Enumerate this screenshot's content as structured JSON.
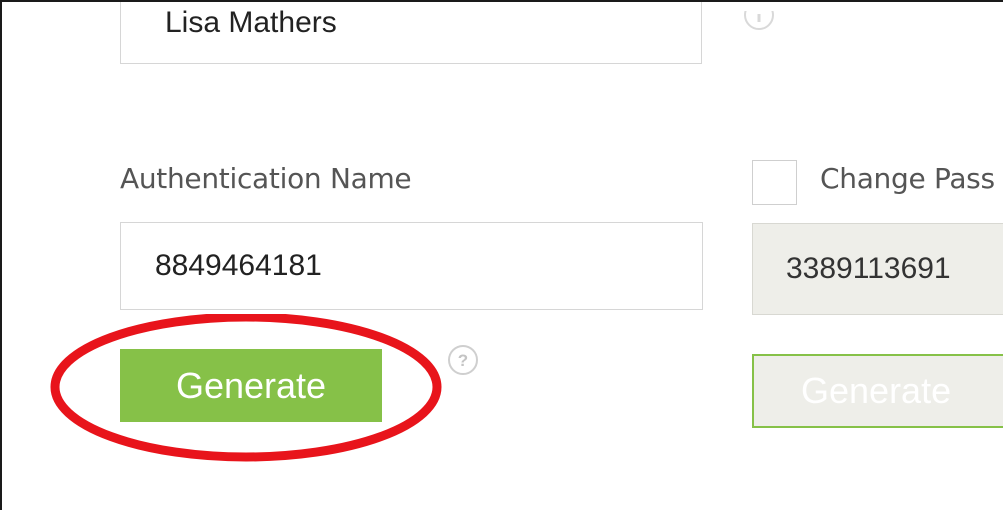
{
  "user_select": {
    "value": "Lisa Mathers",
    "caret_icon": "chevron-down-icon"
  },
  "authentication": {
    "label": "Authentication Name",
    "value": "8849464181",
    "generate_label": "Generate",
    "help_icon": "question-mark-icon"
  },
  "password": {
    "checkbox_label": "Change Pass",
    "checked": false,
    "value": "3389113691",
    "generate_label": "Generate",
    "disabled": true
  },
  "annotation": {
    "shape": "ellipse",
    "color": "#e8141b"
  },
  "colors": {
    "accent_green": "#86c148",
    "disabled_bg": "#eeeee9",
    "label_gray": "#555555"
  }
}
